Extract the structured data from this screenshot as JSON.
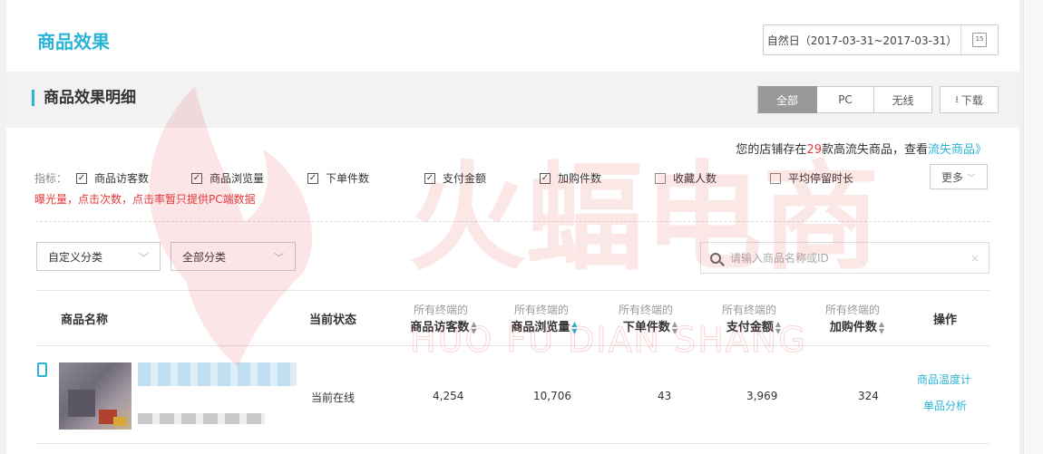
{
  "header": {
    "title": "商品效果"
  },
  "date_picker": {
    "label": "自然日（2017-03-31~2017-03-31）",
    "icon": "calendar-icon",
    "icon_text": "15"
  },
  "section": {
    "title": "商品效果明细",
    "segments": [
      "全部",
      "PC",
      "无线"
    ],
    "active_segment": "全部",
    "download_label": "下载",
    "download_icon": "download-icon"
  },
  "notice": {
    "prefix": "您的店铺存在",
    "count": "29",
    "suffix": "款高流失商品，查看",
    "link": "流失商品》"
  },
  "metrics": {
    "label": "指标：",
    "items": [
      {
        "label": "商品访客数",
        "checked": true
      },
      {
        "label": "商品浏览量",
        "checked": true
      },
      {
        "label": "下单件数",
        "checked": true
      },
      {
        "label": "支付金额",
        "checked": true
      },
      {
        "label": "加购件数",
        "checked": true
      },
      {
        "label": "收藏人数",
        "checked": false
      },
      {
        "label": "平均停留时长",
        "checked": false
      }
    ],
    "more_label": "更多",
    "warning": "曝光量，点击次数，点击率暂只提供PC端数据"
  },
  "filters": {
    "custom_category": "自定义分类",
    "all_category": "全部分类",
    "search_placeholder": "请输入商品名称或ID",
    "clear_icon": "×"
  },
  "table": {
    "headers": {
      "name": "商品名称",
      "status": "当前状态",
      "visitors_sub": "所有终端的",
      "visitors": "商品访客数",
      "views_sub": "所有终端的",
      "views": "商品浏览量",
      "orders_sub": "所有终端的",
      "orders": "下单件数",
      "payment_sub": "所有终端的",
      "payment": "支付金额",
      "cart_sub": "所有终端的",
      "cart": "加购件数",
      "actions": "操作"
    },
    "rows": [
      {
        "status": "当前在线",
        "visitors": "4,254",
        "views": "10,706",
        "orders": "43",
        "payment": "3,969",
        "cart": "324",
        "actions": [
          "商品温度计",
          "单品分析"
        ]
      }
    ]
  },
  "watermark": {
    "text": "火蝠电商",
    "latin": "HUO FU DIAN SHANG",
    "color": "#e8393c"
  },
  "colors": {
    "accent": "#2bb3d6",
    "warning": "#e4393c",
    "segment_active": "#999999"
  }
}
